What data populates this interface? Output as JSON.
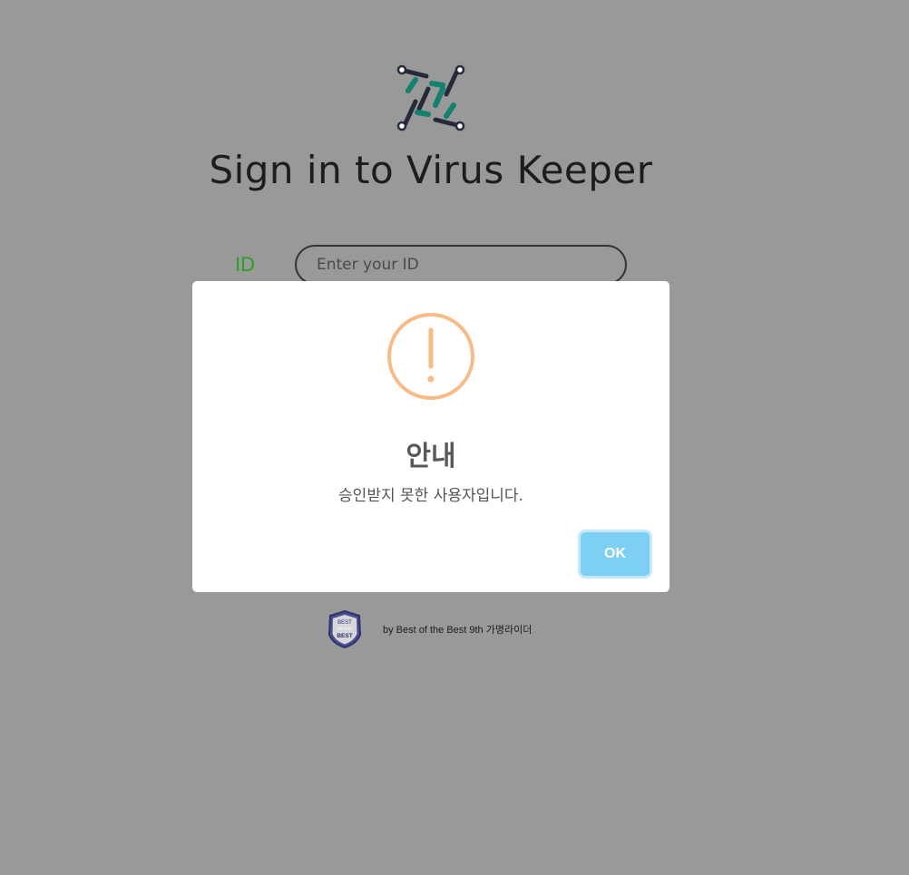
{
  "page": {
    "title": "Sign in to Virus Keeper",
    "id_label": "ID",
    "id_placeholder": "Enter your ID",
    "id_value": "",
    "footer_text": "by Best of the Best 9th 가명라이더",
    "logo_icon": "virus-keeper-logo-icon",
    "badge_icon": "best-of-the-best-badge-icon",
    "badge_text": [
      "BEST",
      "OF THE",
      "BEST"
    ]
  },
  "dialog": {
    "icon": "warning-exclamation-icon",
    "title": "안내",
    "message": "승인받지 못한 사용자입니다.",
    "ok_label": "OK"
  },
  "colors": {
    "background": "#999999",
    "id_label": "#2aa025",
    "warning": "#f8bb86",
    "ok_button": "#7ecff4",
    "logo_teal": "#14816f",
    "logo_dark": "#252b3a"
  }
}
